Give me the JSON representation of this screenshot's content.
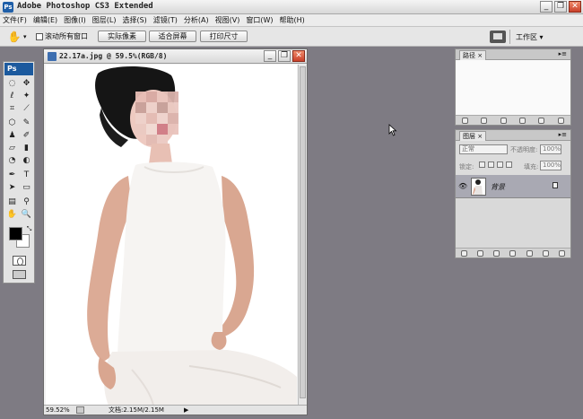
{
  "app": {
    "title": "Adobe Photoshop CS3 Extended",
    "logo": "Ps",
    "window_buttons": {
      "minimize": "_",
      "restore": "❐",
      "close": "✕"
    }
  },
  "menu": [
    "文件(F)",
    "编辑(E)",
    "图像(I)",
    "图层(L)",
    "选择(S)",
    "滤镜(T)",
    "分析(A)",
    "视图(V)",
    "窗口(W)",
    "帮助(H)"
  ],
  "options": {
    "checkbox_label": "滚动所有窗口",
    "btn_actual": "实际像素",
    "btn_fit": "适合屏幕",
    "btn_print": "打印尺寸",
    "workspace": "工作区 ▾"
  },
  "document": {
    "title": "22.17a.jpg @ 59.5%(RGB/8)",
    "zoom": "59.52%",
    "doc_size": "文档:2.15M/2.15M"
  },
  "paths_panel": {
    "tab": "路径 ×",
    "menu": "▸≡"
  },
  "layers_panel": {
    "tab": "图层 ×",
    "menu": "▸≡",
    "blend_mode": "正常",
    "opacity_label": "不透明度:",
    "opacity_value": "100%",
    "lock_label": "锁定:",
    "fill_label": "填充:",
    "fill_value": "100%",
    "layer_name": "背景"
  },
  "colors": {
    "workspace_bg": "#7e7b83",
    "ps_blue": "#1c5a9e",
    "selected_layer": "#a9a9b3"
  }
}
